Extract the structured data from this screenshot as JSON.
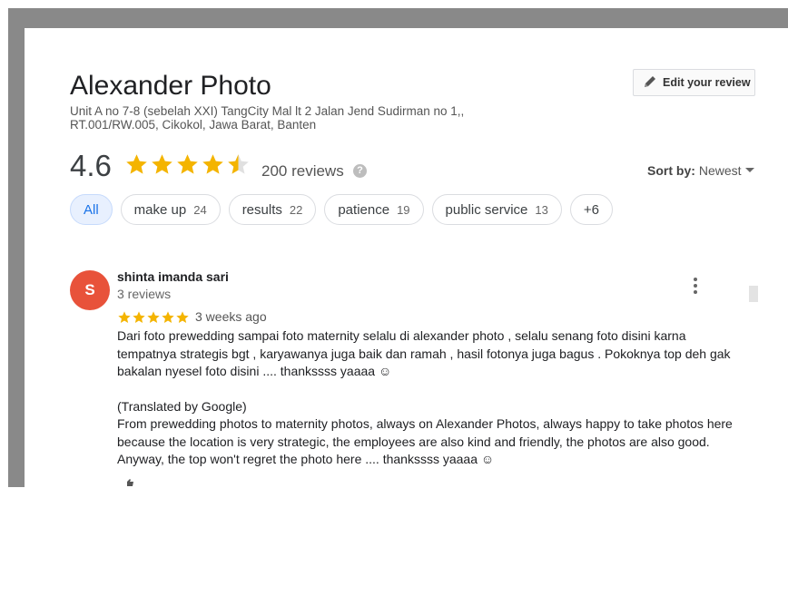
{
  "place": {
    "name": "Alexander Photo",
    "address": "Unit A no 7-8 (sebelah XXI) TangCity Mal lt 2 Jalan Jend Sudirman no 1,, RT.001/RW.005, Cikokol, Jawa Barat, Banten"
  },
  "edit_review": {
    "label": "Edit your review",
    "icon": "pencil-icon"
  },
  "summary": {
    "rating": "4.6",
    "rating_value": 4.6,
    "stars_max": 5,
    "reviews_label": "200 reviews",
    "help_icon": "?"
  },
  "sort": {
    "label": "Sort by:",
    "value": "Newest"
  },
  "chips": [
    {
      "label": "All",
      "count": ""
    },
    {
      "label": "make up",
      "count": "24"
    },
    {
      "label": "results",
      "count": "22"
    },
    {
      "label": "patience",
      "count": "19"
    },
    {
      "label": "public service",
      "count": "13"
    },
    {
      "label": "+6",
      "count": ""
    }
  ],
  "review": {
    "avatar_letter": "S",
    "avatar_color": "#e8523a",
    "author": "shinta imanda sari",
    "author_meta": "3 reviews",
    "stars": 5,
    "date": "3 weeks ago",
    "original_text": "Dari foto prewedding sampai foto maternity selalu di alexander photo , selalu senang foto disini karna tempatnya strategis bgt , karyawanya juga baik dan ramah , hasil fotonya juga bagus . Pokoknya top deh gak bakalan nyesel foto disini .... thankssss yaaaa ☺",
    "translated_label": "(Translated by Google)",
    "translated_text": "From prewedding photos to maternity photos, always on Alexander Photos, always happy to take photos here because the location is very strategic, the employees are also kind and friendly, the photos are also good. Anyway, the top won't regret the photo here .... thankssss yaaaa ☺"
  },
  "colors": {
    "star": "#f4b400",
    "accent": "#1a73e8",
    "frame": "#898989"
  }
}
